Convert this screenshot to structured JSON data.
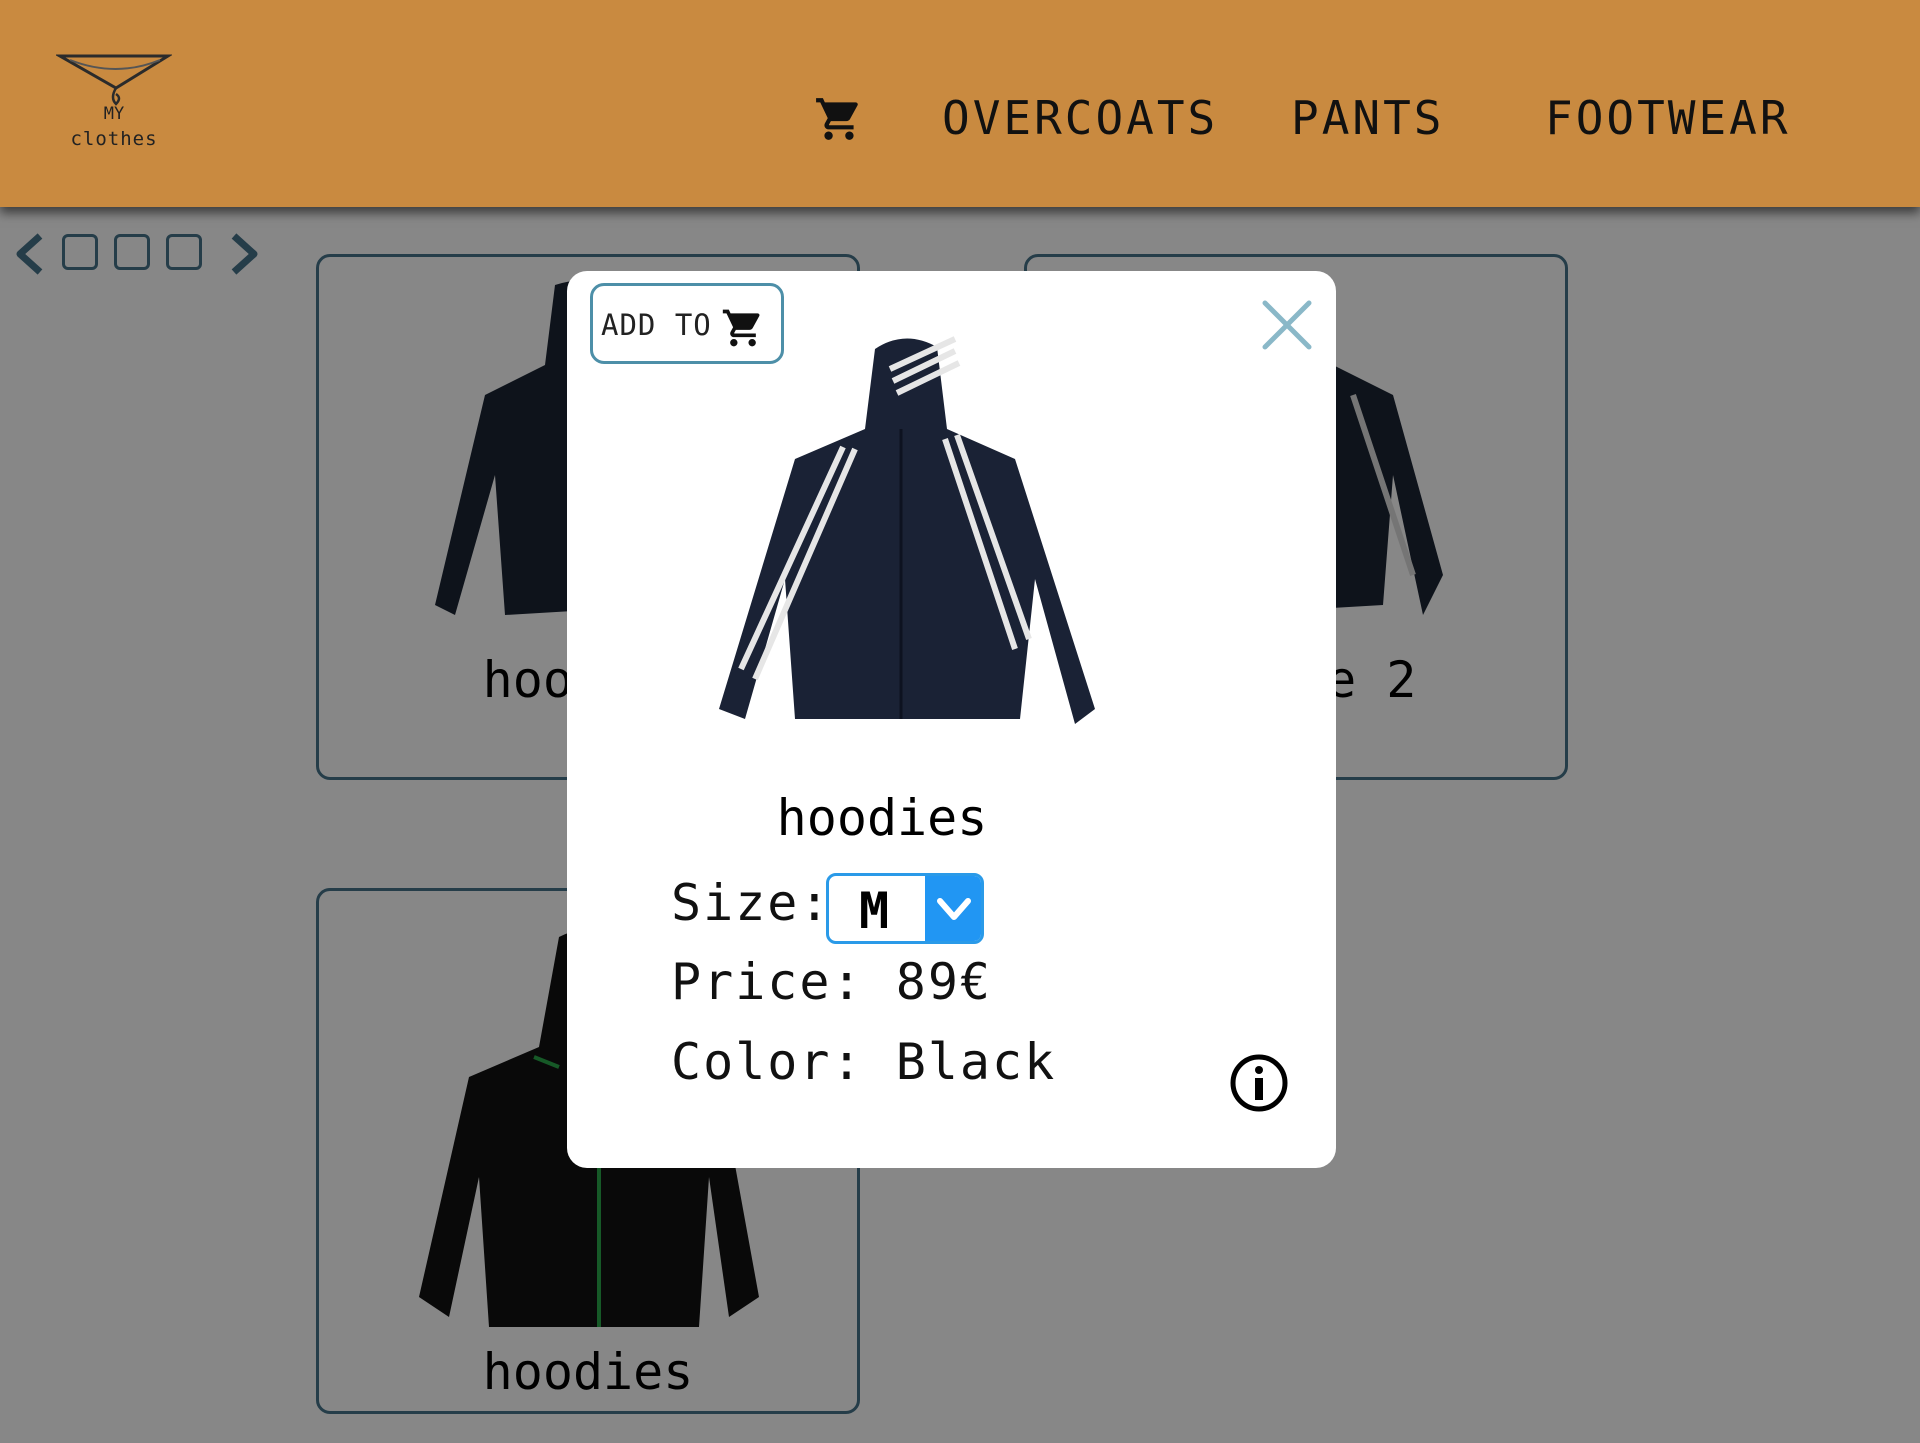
{
  "header": {
    "logo_line1": "MY",
    "logo_line2": "clothes",
    "nav": [
      "OVERCOATS",
      "PANTS",
      "FOOTWEAR"
    ],
    "cart_icon": "cart-icon"
  },
  "pager": {
    "prev_icon": "chevron-left-icon",
    "next_icon": "chevron-right-icon",
    "page_count": 3
  },
  "cards": [
    {
      "title": "hoodies"
    },
    {
      "title": "hoodie 2"
    },
    {
      "title": "hoodies"
    }
  ],
  "modal": {
    "add_to_cart_label": "ADD TO",
    "title": "hoodies",
    "size_label": "Size:",
    "size_value": "M",
    "price_line": "Price: 89€",
    "color_line": "Color: Black",
    "close_icon": "close-icon",
    "info_icon": "info-icon"
  },
  "colors": {
    "header": "#c98a40",
    "border_accent": "#47748a",
    "select_accent": "#2196f3"
  }
}
